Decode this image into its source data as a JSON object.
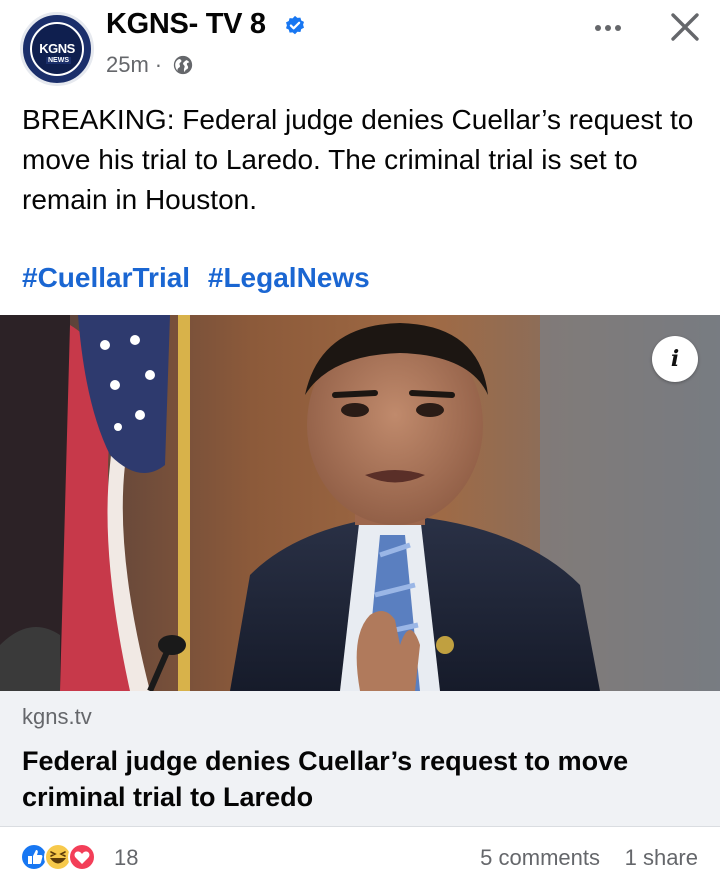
{
  "post": {
    "page_name": "KGNS- TV 8",
    "avatar_text": "KGNS",
    "avatar_subtext": "NEWS",
    "time": "25m",
    "meta_separator": "·",
    "text": "BREAKING: Federal judge denies Cuellar’s request to move his trial to Laredo. The criminal trial is set to remain in Houston.",
    "hashtags": [
      "#CuellarTrial",
      "#LegalNews"
    ]
  },
  "photo": {
    "info_label": "i"
  },
  "link": {
    "domain": "kgns.tv",
    "title": "Federal judge denies Cuellar’s request to move criminal trial to Laredo"
  },
  "footer": {
    "reaction_count": "18",
    "comments": "5 comments",
    "shares": "1 share"
  },
  "icons": {
    "verified": "verified-badge-icon",
    "audience": "globe-icon",
    "more": "more-options-icon",
    "close": "close-icon",
    "reactions": [
      "like-reaction-icon",
      "haha-reaction-icon",
      "love-reaction-icon"
    ]
  },
  "colors": {
    "hashtag": "#1a66d2",
    "verified": "#1877f2",
    "muted": "#65676b",
    "link_card_bg": "#f0f2f5"
  }
}
